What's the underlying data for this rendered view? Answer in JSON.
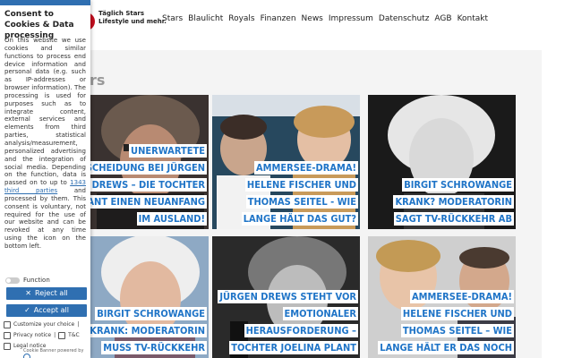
{
  "header": {
    "logo_line1": "Täglich Stars",
    "logo_line2": "Lifestyle und mehr.",
    "nav": [
      "Stars",
      "Blaulicht",
      "Royals",
      "Finanzen",
      "News",
      "Impressum",
      "Datenschutz",
      "AGB",
      "Kontakt"
    ]
  },
  "section": {
    "title": "rs"
  },
  "articles": [
    {
      "caption": "Unerwartete Entscheidung bei Jürgen Drews – Die Tochter plant einen Neuanfang im Ausland!"
    },
    {
      "caption": "Ammersee-Drama! Helene Fischer und Thomas Seitel - Wie lange hält das gut?"
    },
    {
      "caption": "Birgit Schrowange krank? Moderatorin sagt TV-Rückkehr ab"
    },
    {
      "caption": "Birgit Schrowange krank: Moderatorin muss TV-Rückkehr"
    },
    {
      "caption": "Jürgen Drews steht vor emotionaler Herausforderung – Tochter Joelina plant"
    },
    {
      "caption": "Ammersee-Drama! Helene Fischer und Thomas Seitel – Wie lange hält er das noch"
    }
  ],
  "cookie": {
    "title": "Consent to Cookies & Data processing",
    "body_before_link": "On this website we use cookies and similar functions to process end device information and personal data (e.g. such as IP-addresses or browser information). The processing is used for purposes such as to integrate content, external services and elements from third parties, statistical analysis/measurement, personalized advertising and the integration of social media. Depending on the function, data is passed on to up to",
    "link_text": "1343 third parties",
    "body_after_link": "and processed by them. This consent is voluntary, not required for the use of our website and can be revoked at any time using the icon on the bottom left.",
    "toggle_label": "Function",
    "reject_label": "Reject all",
    "accept_label": "Accept all",
    "customize_label": "Customize your choice",
    "privacy_label": "Privacy notice",
    "tc_label": "T&C",
    "legal_label": "Legal notice",
    "powered_label": "Cookie Banner powered by"
  },
  "colors": {
    "accent": "#2f6fb1",
    "caption_text": "#1f74c7",
    "brand_red": "#c40d1e"
  }
}
